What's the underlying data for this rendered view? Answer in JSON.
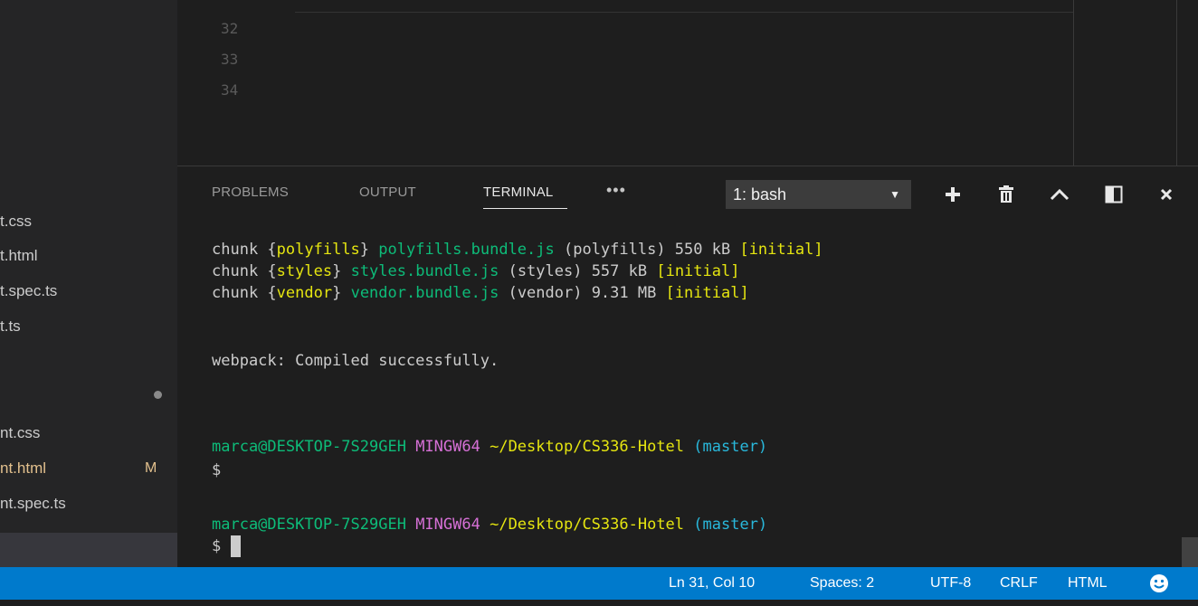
{
  "sidebar": {
    "files": [
      {
        "name": "t.css",
        "badge": ""
      },
      {
        "name": "t.html",
        "badge": ""
      },
      {
        "name": "t.spec.ts",
        "badge": ""
      },
      {
        "name": "t.ts",
        "badge": ""
      },
      {
        "name": "nt.css",
        "badge": ""
      },
      {
        "name": "nt.html",
        "badge": "M"
      },
      {
        "name": "nt.spec.ts",
        "badge": ""
      }
    ]
  },
  "editor": {
    "line_numbers": [
      "32",
      "33",
      "34"
    ]
  },
  "panel": {
    "tabs": [
      {
        "label": "PROBLEMS",
        "active": false
      },
      {
        "label": "OUTPUT",
        "active": false
      },
      {
        "label": "TERMINAL",
        "active": true
      }
    ],
    "more_label": "•••",
    "terminal_select": {
      "selected": "1: bash"
    },
    "tools": [
      "plus-icon",
      "trash-icon",
      "chevron-up-icon",
      "split-panel-icon",
      "close-icon"
    ]
  },
  "terminal": {
    "chunk_lines": [
      {
        "prefix": "chunk ",
        "bopen": "{",
        "chunk": "polyfills",
        "bclose": "}",
        "file": " polyfills.bundle.js",
        "meta": " (polyfills) 550 kB ",
        "tag": "[initial]"
      },
      {
        "prefix": "chunk ",
        "bopen": "{",
        "chunk": "styles",
        "bclose": "}",
        "file": " styles.bundle.js",
        "meta": " (styles) 557 kB ",
        "tag": "[initial]"
      },
      {
        "prefix": "chunk ",
        "bopen": "{",
        "chunk": "vendor",
        "bclose": "}",
        "file": " vendor.bundle.js",
        "meta": " (vendor) 9.31 MB ",
        "tag": "[initial]"
      }
    ],
    "message": "webpack: Compiled successfully.",
    "prompts": [
      {
        "user": "marca@DESKTOP-7S29GEH",
        "env": "MINGW64",
        "path": "~/Desktop/CS336-Hotel",
        "branch": "(master)",
        "symbol": "$"
      },
      {
        "user": "marca@DESKTOP-7S29GEH",
        "env": "MINGW64",
        "path": "~/Desktop/CS336-Hotel",
        "branch": "(master)",
        "symbol": "$"
      }
    ]
  },
  "statusbar": {
    "position": "Ln 31, Col 10",
    "spaces": "Spaces: 2",
    "encoding": "UTF-8",
    "eol": "CRLF",
    "language": "HTML",
    "feedback_icon": "smiley-icon"
  },
  "colors": {
    "statusbar_bg": "#007acc",
    "panel_bg": "#1e1e1e",
    "sidebar_bg": "#252526"
  }
}
